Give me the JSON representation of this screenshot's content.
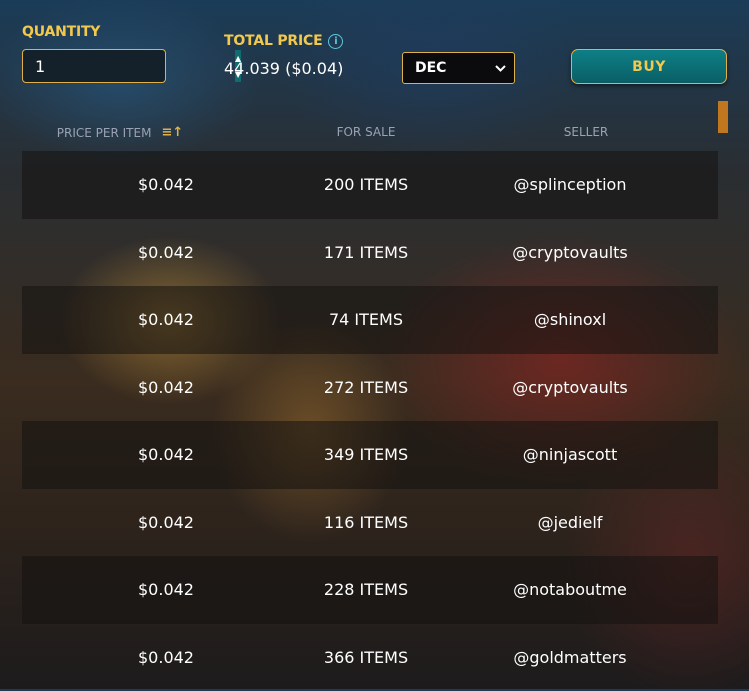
{
  "quantity": {
    "label": "QUANTITY",
    "value": "1"
  },
  "total": {
    "label": "TOTAL PRICE",
    "value": "44.039 ($0.04)"
  },
  "currency": {
    "selected": "DEC"
  },
  "buy_label": "BUY",
  "columns": {
    "price": "PRICE PER ITEM",
    "for_sale": "FOR SALE",
    "seller": "SELLER"
  },
  "rows": [
    {
      "price": "$0.042",
      "for_sale": "200 ITEMS",
      "seller": "@splinception"
    },
    {
      "price": "$0.042",
      "for_sale": "171 ITEMS",
      "seller": "@cryptovaults"
    },
    {
      "price": "$0.042",
      "for_sale": "74 ITEMS",
      "seller": "@shinoxl"
    },
    {
      "price": "$0.042",
      "for_sale": "272 ITEMS",
      "seller": "@cryptovaults"
    },
    {
      "price": "$0.042",
      "for_sale": "349 ITEMS",
      "seller": "@ninjascott"
    },
    {
      "price": "$0.042",
      "for_sale": "116 ITEMS",
      "seller": "@jedielf"
    },
    {
      "price": "$0.042",
      "for_sale": "228 ITEMS",
      "seller": "@notaboutme"
    },
    {
      "price": "$0.042",
      "for_sale": "366 ITEMS",
      "seller": "@goldmatters"
    }
  ],
  "colors": {
    "accent_gold": "#f2c94c",
    "teal": "#0e7f86",
    "scroll": "#c1771d"
  },
  "icons": {
    "info": "info-icon",
    "sort": "sort-icon",
    "dropdown": "chevron-down-icon",
    "stepper": "stepper-icons"
  }
}
